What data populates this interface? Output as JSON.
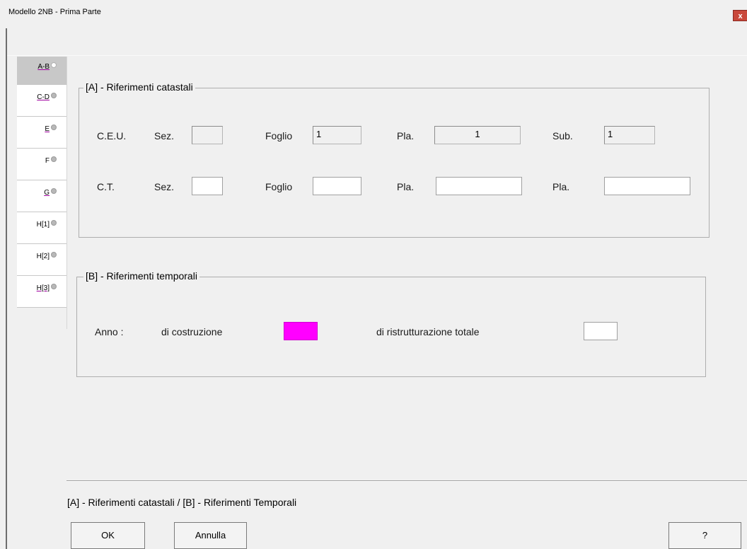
{
  "window": {
    "title": "Modello 2NB - Prima Parte",
    "close_glyph": "x"
  },
  "tabs": [
    {
      "label": "A-B",
      "active": true
    },
    {
      "label": "C-D",
      "active": false
    },
    {
      "label": "E",
      "active": false
    },
    {
      "label": "F",
      "active": false
    },
    {
      "label": "G",
      "active": false
    },
    {
      "label": "H[1]",
      "active": false
    },
    {
      "label": "H[2]",
      "active": false
    },
    {
      "label": "H[3]",
      "active": false
    }
  ],
  "section_a": {
    "legend": "[A] - Riferimenti catastali",
    "ceu": {
      "label": "C.E.U.",
      "sez_label": "Sez.",
      "sez_value": "",
      "foglio_label": "Foglio",
      "foglio_value": "1",
      "pla_label": "Pla.",
      "pla_value": "1",
      "sub_label": "Sub.",
      "sub_value": "1"
    },
    "ct": {
      "label": "C.T.",
      "sez_label": "Sez.",
      "sez_value": "",
      "foglio_label": "Foglio",
      "foglio_value": "",
      "pla_label": "Pla.",
      "pla_value": "",
      "pla2_label": "Pla.",
      "pla2_value": ""
    }
  },
  "section_b": {
    "legend": "[B] - Riferimenti temporali",
    "anno_label": "Anno :",
    "costruzione_label": "di costruzione",
    "costruzione_value": "",
    "ristrutturazione_label": "di ristrutturazione totale",
    "ristrutturazione_value": ""
  },
  "status_text": "[A] - Riferimenti catastali / [B] - Riferimenti Temporali",
  "buttons": {
    "ok": "OK",
    "cancel": "Annulla",
    "help": "?"
  },
  "colors": {
    "required_field": "#ff00ff",
    "close_button": "#c9483b"
  }
}
